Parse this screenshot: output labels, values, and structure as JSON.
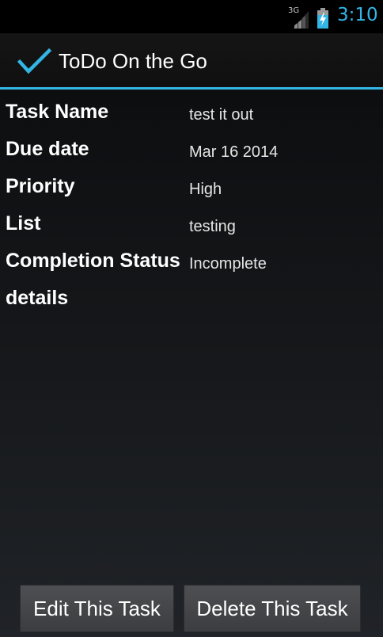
{
  "status_bar": {
    "network": "3G",
    "time": "3:10",
    "accent_color": "#33b5e5"
  },
  "action_bar": {
    "icon": "checkmark-icon",
    "title": "ToDo On the Go"
  },
  "fields": [
    {
      "label": "Task Name",
      "value": "test it out"
    },
    {
      "label": "Due date",
      "value": "Mar 16 2014"
    },
    {
      "label": "Priority",
      "value": "High"
    },
    {
      "label": "List",
      "value": "testing"
    },
    {
      "label": "Completion Status",
      "value": "Incomplete"
    },
    {
      "label": "details",
      "value": ""
    }
  ],
  "buttons": {
    "edit_label": "Edit This Task",
    "delete_label": "Delete This Task"
  }
}
